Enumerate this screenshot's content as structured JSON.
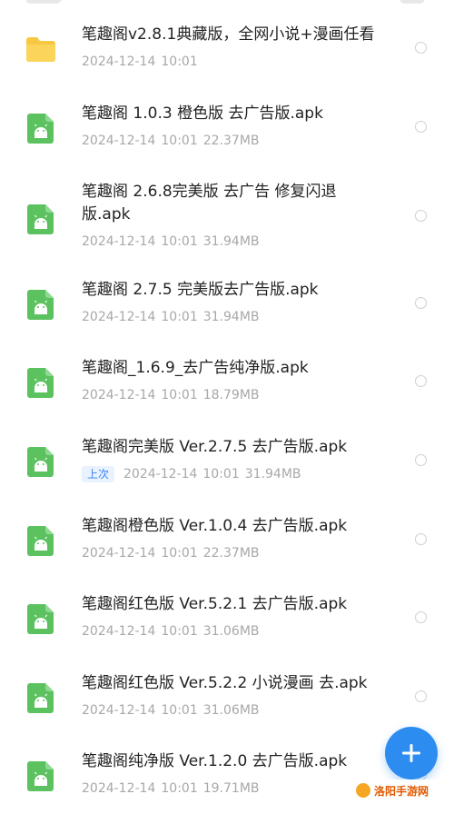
{
  "colors": {
    "apk_green": "#5cc25f",
    "folder_yellow": "#f7c843",
    "accent_blue": "#2d8cf0",
    "meta_gray": "#a8a8a8"
  },
  "files": [
    {
      "name": "笔趣阁v2.8.1典藏版，全网小说+漫画任看",
      "date": "2024-12-14",
      "time": "10:01",
      "size": "",
      "icon": "folder-icon",
      "badge": ""
    },
    {
      "name": "笔趣阁 1.0.3 橙色版 去广告版.apk",
      "date": "2024-12-14",
      "time": "10:01",
      "size": "22.37MB",
      "icon": "apk-file-icon",
      "badge": ""
    },
    {
      "name": "笔趣阁 2.6.8完美版 去广告 修复闪退版.apk",
      "date": "2024-12-14",
      "time": "10:01",
      "size": "31.94MB",
      "icon": "apk-file-icon",
      "badge": ""
    },
    {
      "name": "笔趣阁 2.7.5 完美版去广告版.apk",
      "date": "2024-12-14",
      "time": "10:01",
      "size": "31.94MB",
      "icon": "apk-file-icon",
      "badge": ""
    },
    {
      "name": "笔趣阁_1.6.9_去广告纯净版.apk",
      "date": "2024-12-14",
      "time": "10:01",
      "size": "18.79MB",
      "icon": "apk-file-icon",
      "badge": ""
    },
    {
      "name": "笔趣阁完美版 Ver.2.7.5 去广告版.apk",
      "date": "2024-12-14",
      "time": "10:01",
      "size": "31.94MB",
      "icon": "apk-file-icon",
      "badge": "上次"
    },
    {
      "name": "笔趣阁橙色版 Ver.1.0.4 去广告版.apk",
      "date": "2024-12-14",
      "time": "10:01",
      "size": "22.37MB",
      "icon": "apk-file-icon",
      "badge": ""
    },
    {
      "name": "笔趣阁红色版 Ver.5.2.1 去广告版.apk",
      "date": "2024-12-14",
      "time": "10:01",
      "size": "31.06MB",
      "icon": "apk-file-icon",
      "badge": ""
    },
    {
      "name": "笔趣阁红色版 Ver.5.2.2 小说漫画 去.apk",
      "date": "2024-12-14",
      "time": "10:01",
      "size": "31.06MB",
      "icon": "apk-file-icon",
      "badge": ""
    },
    {
      "name": "笔趣阁纯净版 Ver.1.2.0 去广告版.apk",
      "date": "2024-12-14",
      "time": "10:01",
      "size": "19.71MB",
      "icon": "apk-file-icon",
      "badge": ""
    }
  ],
  "fab": {
    "label": "+",
    "icon": "plus-icon"
  },
  "watermark": {
    "text": "洛阳手游网"
  }
}
